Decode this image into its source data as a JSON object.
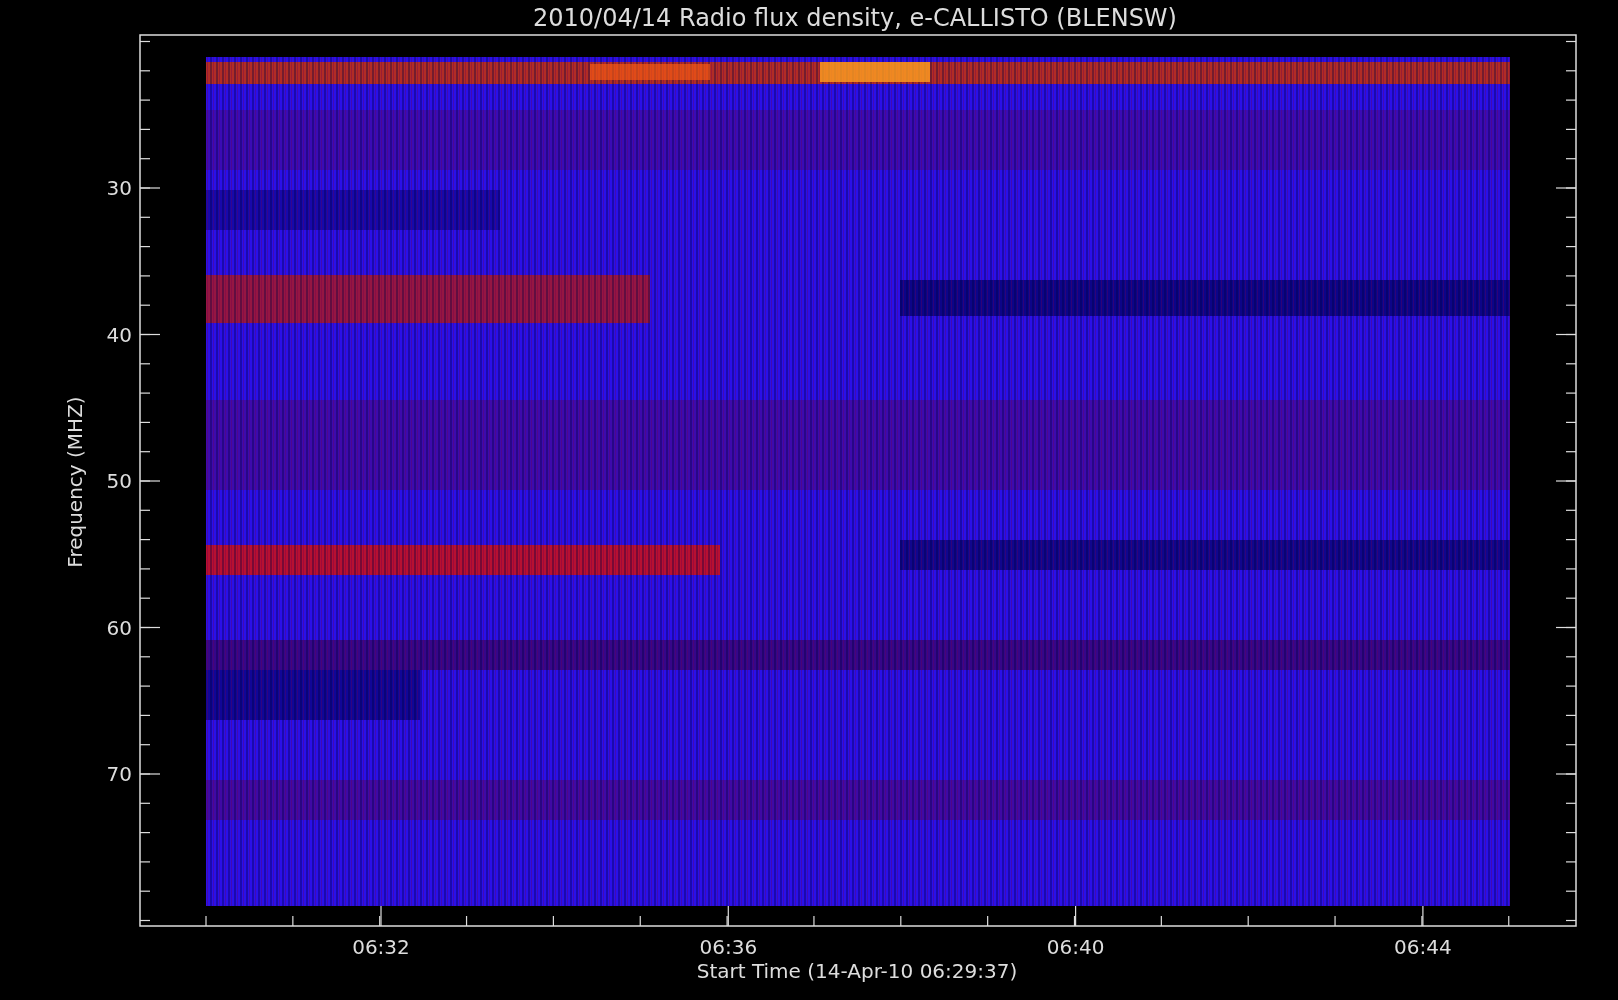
{
  "title": "2010/04/14  Radio flux density, e-CALLISTO (BLENSW)",
  "y_axis": {
    "label": "Frequency (MHZ)",
    "ticks": [
      "30",
      "40",
      "50",
      "60",
      "70"
    ]
  },
  "x_axis": {
    "label": "Start Time (14-Apr-10 06:29:37)",
    "ticks": [
      "06:32",
      "06:36",
      "06:40",
      "06:44"
    ]
  }
}
